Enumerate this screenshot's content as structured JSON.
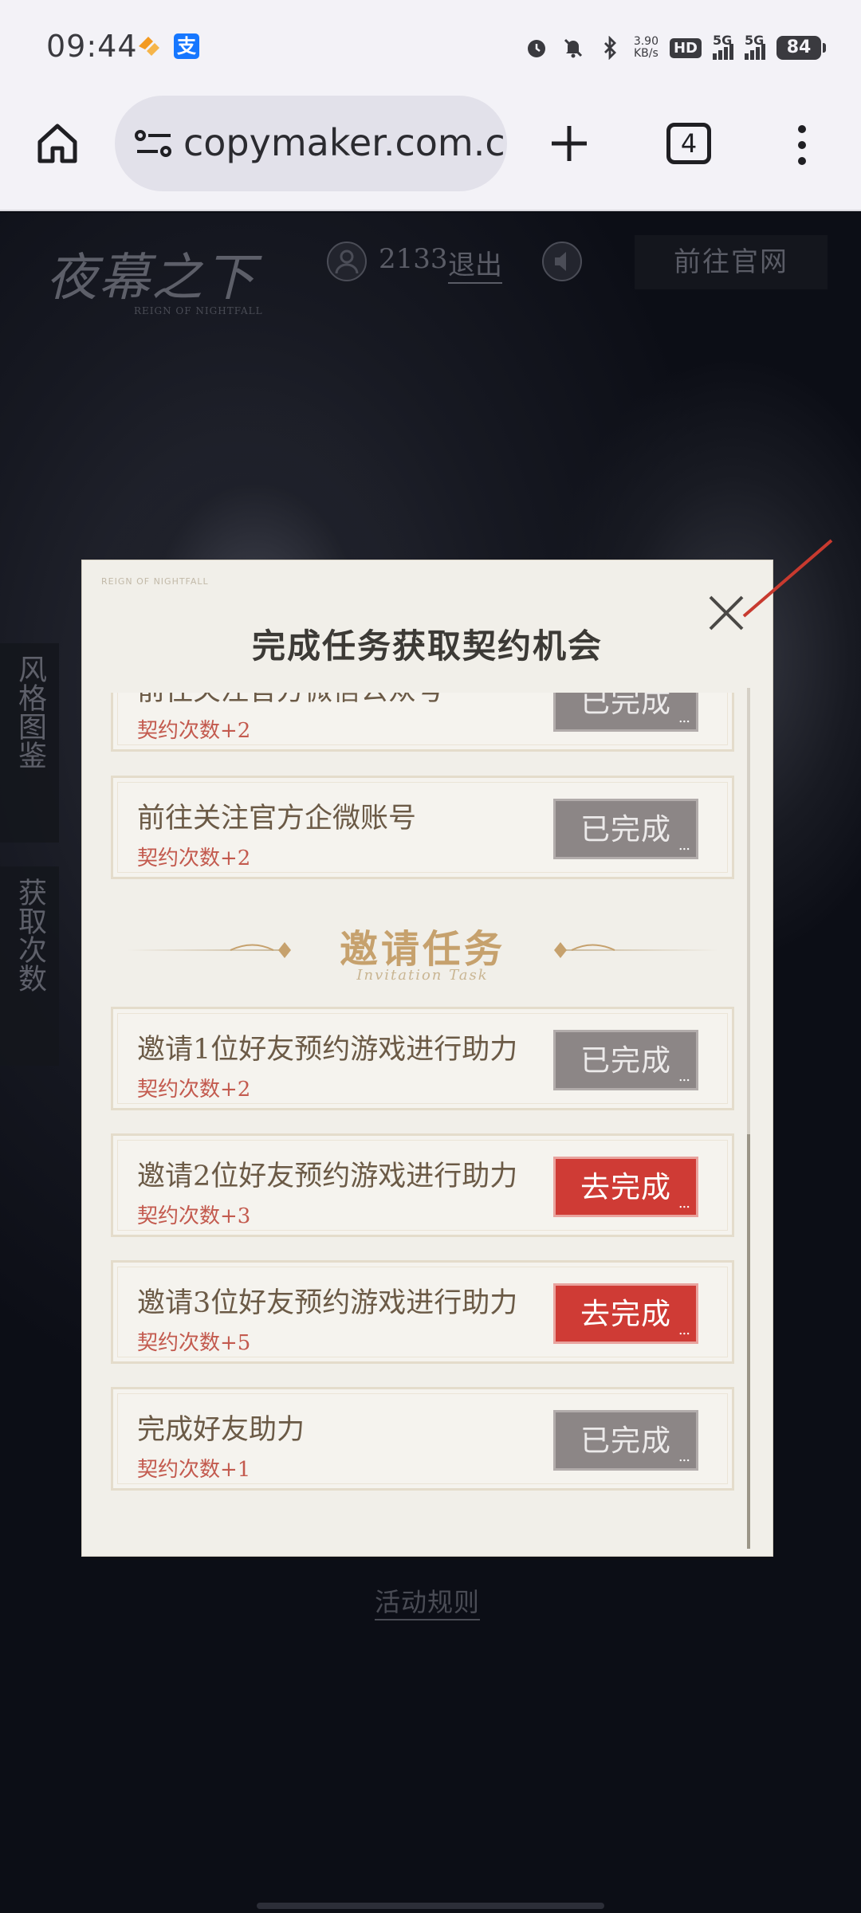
{
  "status_bar": {
    "time": "09:44",
    "net_speed_value": "3.90",
    "net_speed_unit": "KB/s",
    "hd_label": "HD",
    "hd_sub": "1 2",
    "sig1_label": "5G",
    "sig2_label": "5G",
    "battery": "84",
    "app_icon_2_glyph": "支"
  },
  "browser": {
    "url": "copymaker.com.cn",
    "tab_count": "4"
  },
  "page": {
    "logo_text": "夜幕之下",
    "logo_sub": "REIGN OF NIGHTFALL",
    "user_id": "2133",
    "logout_label": "退出",
    "official_site_label": "前往官网",
    "side_tab_1": "风格图鉴",
    "side_tab_2": "获取次数",
    "rules_label": "活动规则"
  },
  "modal": {
    "brand_mark": "REIGN OF NIGHTFALL",
    "title": "完成任务获取契约机会",
    "partial_task": {
      "name": "前往关注官方微信公众号",
      "reward": "契约次数+2",
      "button": "已完成"
    },
    "tasks_top": [
      {
        "name": "前往关注官方企微账号",
        "reward": "契约次数+2",
        "button": "已完成",
        "state": "done"
      }
    ],
    "section": {
      "title": "邀请任务",
      "subtitle": "Invitation Task"
    },
    "tasks_invite": [
      {
        "name": "邀请1位好友预约游戏进行助力",
        "reward": "契约次数+2",
        "button": "已完成",
        "state": "done"
      },
      {
        "name": "邀请2位好友预约游戏进行助力",
        "reward": "契约次数+3",
        "button": "去完成",
        "state": "todo"
      },
      {
        "name": "邀请3位好友预约游戏进行助力",
        "reward": "契约次数+5",
        "button": "去完成",
        "state": "todo"
      },
      {
        "name": "完成好友助力",
        "reward": "契约次数+1",
        "button": "已完成",
        "state": "done"
      }
    ]
  },
  "colors": {
    "done_button": "#8c8686",
    "todo_button": "#cf3b35",
    "reward_text": "#c35a4e",
    "section_gold": "#c6a16d"
  },
  "icons": {
    "home": "home-icon",
    "site_info": "site-info-icon",
    "new_tab": "plus-icon",
    "tabs": "tab-switcher-icon",
    "menu": "more-vert-icon",
    "close": "close-icon"
  }
}
